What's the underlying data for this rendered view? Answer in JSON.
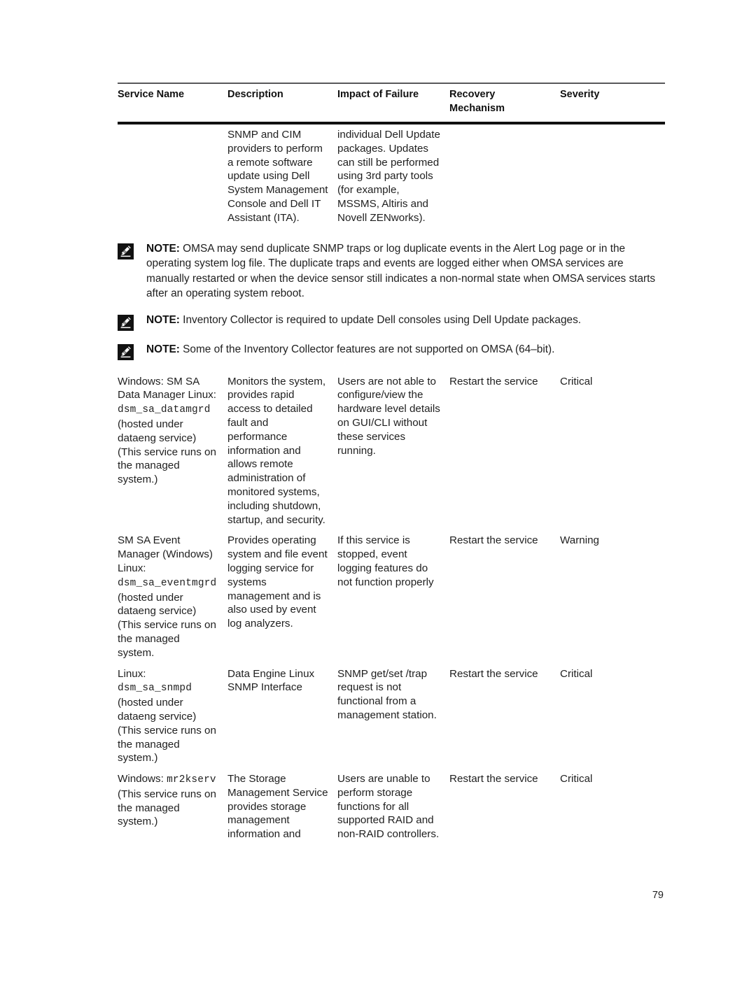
{
  "document": {
    "page_number": "79"
  },
  "table": {
    "headers": [
      "Service Name",
      "Description",
      "Impact of Failure",
      "Recovery Mechanism",
      "Severity"
    ],
    "rows": [
      {
        "service_name": "",
        "service_name_mono": "",
        "service_name_tail": "",
        "description": "SNMP and CIM providers to perform a remote software update using Dell System Management Console and Dell IT Assistant (ITA).",
        "impact": "individual Dell Update packages. Updates can still be performed using 3rd party tools (for example, MSSMS, Altiris and Novell ZENworks).",
        "recovery": "",
        "severity": ""
      },
      {
        "service_name": "Windows: SM SA Data Manager Linux: ",
        "service_name_mono": "dsm_sa_datamgrd",
        "service_name_tail": " (hosted under dataeng service) (This service runs on the managed system.)",
        "description": "Monitors the system, provides rapid access to detailed fault and performance information and allows remote administration of monitored systems, including shutdown, startup, and security.",
        "impact": "Users are not able to configure/view the hardware level details on GUI/CLI without these services running.",
        "recovery": "Restart the service",
        "severity": "Critical"
      },
      {
        "service_name": "SM SA Event Manager (Windows) Linux: ",
        "service_name_mono": "dsm_sa_eventmgrd",
        "service_name_tail": " (hosted under dataeng service) (This service runs on the managed system.",
        "description": "Provides operating system and file event logging service for systems management and is also used by event log analyzers.",
        "impact": "If this service is stopped, event logging features do not function properly",
        "recovery": "Restart the service",
        "severity": "Warning"
      },
      {
        "service_name": "Linux: ",
        "service_name_mono": "dsm_sa_snmpd",
        "service_name_tail": " (hosted under dataeng service) (This service runs on the managed system.)",
        "description": "Data Engine Linux SNMP Interface",
        "impact": "SNMP get/set /trap request is not functional from a management station.",
        "recovery": "Restart the service",
        "severity": "Critical"
      },
      {
        "service_name": "Windows: ",
        "service_name_mono": "mr2kserv",
        "service_name_tail": " (This service runs on the managed system.)",
        "description": "The Storage Management Service provides storage management information and",
        "impact": "Users are unable to perform storage functions for all supported RAID and non-RAID controllers.",
        "recovery": "Restart the service",
        "severity": "Critical"
      }
    ]
  },
  "notes": [
    {
      "label": "NOTE:",
      "text": " OMSA may send duplicate SNMP traps or log duplicate events in the Alert Log page or in the operating system log file. The duplicate traps and events are logged either when OMSA services are manually restarted or when the device sensor still indicates a non-normal state when OMSA services starts after an operating system reboot."
    },
    {
      "label": "NOTE:",
      "text": " Inventory Collector is required to update Dell consoles using Dell Update packages."
    },
    {
      "label": "NOTE:",
      "text": " Some of the Inventory Collector features are not supported on OMSA (64–bit)."
    }
  ]
}
